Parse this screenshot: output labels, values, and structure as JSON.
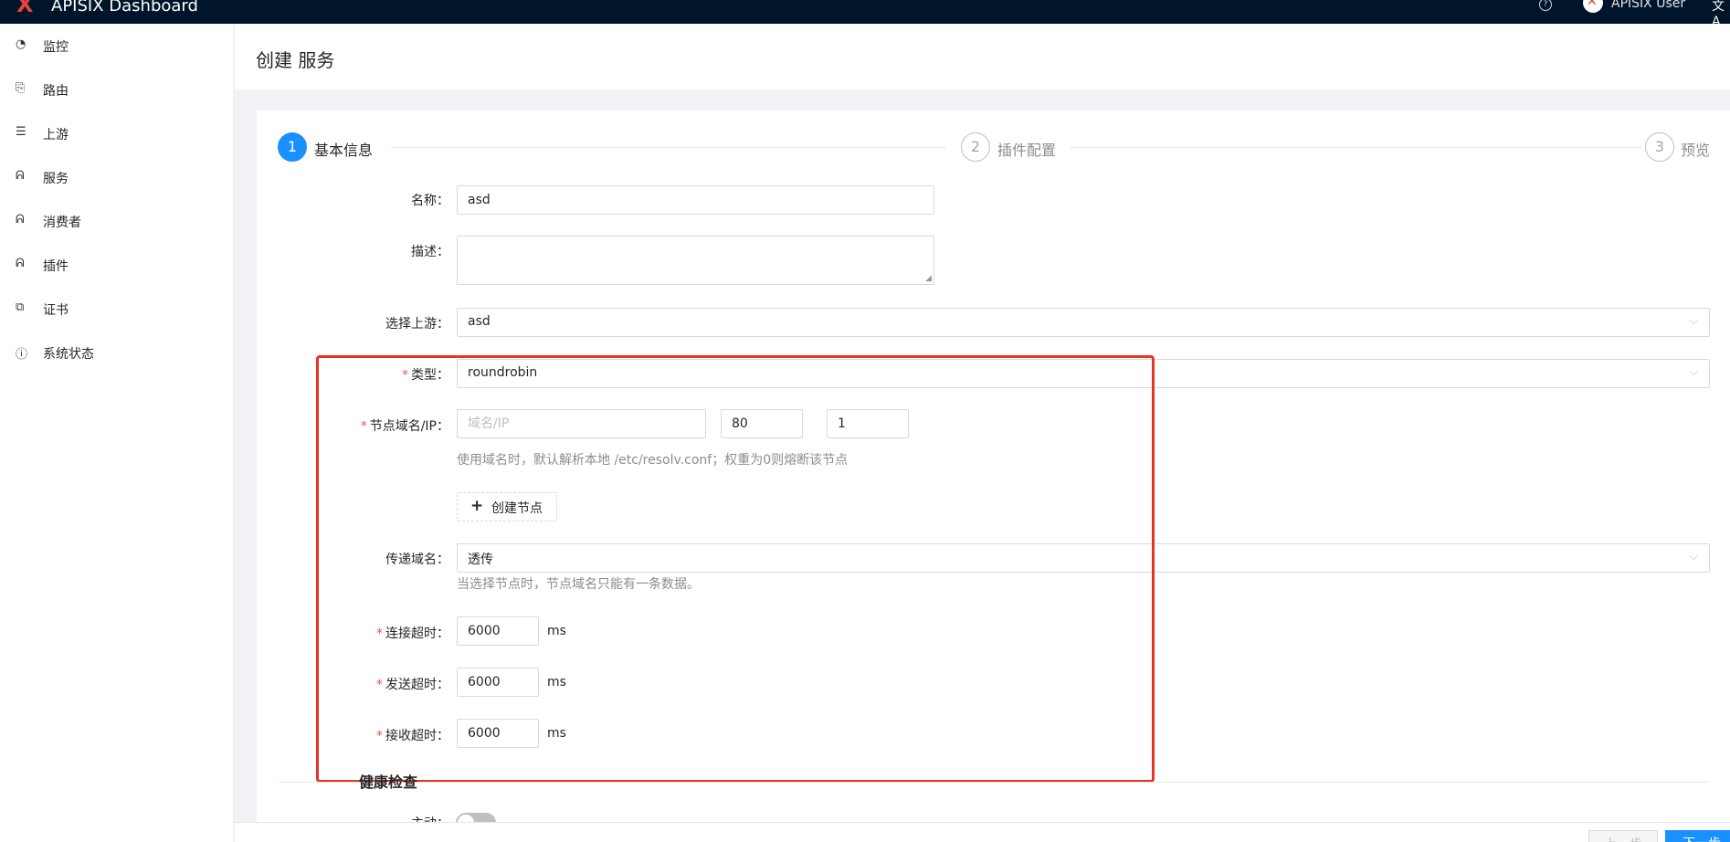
{
  "header": {
    "app_title": "APISIX Dashboard",
    "user_name": "APISIX User",
    "lang_glyph": "文A"
  },
  "sidebar": {
    "items": [
      {
        "label": "监控",
        "icon": "dashboard-icon"
      },
      {
        "label": "路由",
        "icon": "route-icon"
      },
      {
        "label": "上游",
        "icon": "database-icon"
      },
      {
        "label": "服务",
        "icon": "service-icon"
      },
      {
        "label": "消费者",
        "icon": "consumer-icon"
      },
      {
        "label": "插件",
        "icon": "plugin-icon"
      },
      {
        "label": "证书",
        "icon": "certificate-icon"
      },
      {
        "label": "系统状态",
        "icon": "info-icon"
      }
    ]
  },
  "page": {
    "title": "创建 服务"
  },
  "steps": [
    {
      "num": "1",
      "label": "基本信息",
      "status": "active"
    },
    {
      "num": "2",
      "label": "插件配置",
      "status": "wait"
    },
    {
      "num": "3",
      "label": "预览",
      "status": "wait"
    }
  ],
  "form": {
    "name_label": "名称",
    "name_value": "asd",
    "desc_label": "描述",
    "desc_value": "",
    "upstream_label": "选择上游",
    "upstream_value": "asd",
    "type_label": "类型",
    "type_value": "roundrobin",
    "node_label": "节点域名/IP",
    "node_host_placeholder": "域名/IP",
    "node_port_value": "80",
    "node_weight_value": "1",
    "node_hint": "使用域名时，默认解析本地 /etc/resolv.conf；权重为0则熔断该节点",
    "create_node_label": "创建节点",
    "pass_host_label": "传递域名",
    "pass_host_value": "透传",
    "pass_host_hint": "当选择节点时，节点域名只能有一条数据。",
    "connect_timeout_label": "连接超时",
    "connect_timeout_value": "6000",
    "send_timeout_label": "发送超时",
    "send_timeout_value": "6000",
    "read_timeout_label": "接收超时",
    "read_timeout_value": "6000",
    "unit_ms": "ms",
    "health_check_title": "健康检查",
    "active_label": "主动"
  },
  "footer": {
    "prev_label": "上一步",
    "next_label": "下一步"
  },
  "colors": {
    "primary": "#1890ff",
    "topbar": "#001529",
    "highlight": "#e53528",
    "required": "#ff4d4f"
  }
}
